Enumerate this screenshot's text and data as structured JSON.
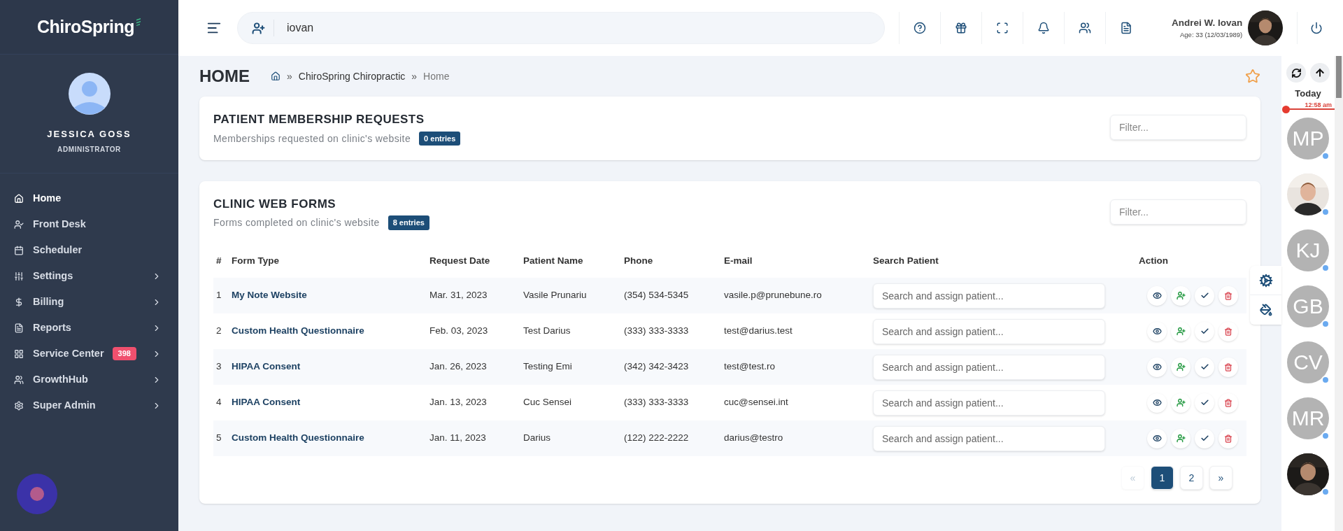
{
  "sidebar": {
    "logo": "ChiroSpring",
    "user": {
      "name": "JESSICA GOSS",
      "role": "ADMINISTRATOR"
    },
    "items": [
      {
        "label": "Home",
        "selected": true,
        "has_submenu": false
      },
      {
        "label": "Front Desk",
        "selected": false,
        "has_submenu": false
      },
      {
        "label": "Scheduler",
        "selected": false,
        "has_submenu": false
      },
      {
        "label": "Settings",
        "selected": false,
        "has_submenu": true
      },
      {
        "label": "Billing",
        "selected": false,
        "has_submenu": true
      },
      {
        "label": "Reports",
        "selected": false,
        "has_submenu": true
      },
      {
        "label": "Service Center",
        "selected": false,
        "has_submenu": true,
        "badge": "398"
      },
      {
        "label": "GrowthHub",
        "selected": false,
        "has_submenu": true
      },
      {
        "label": "Super Admin",
        "selected": false,
        "has_submenu": true
      }
    ]
  },
  "header": {
    "search": {
      "value": "iovan"
    },
    "patient": {
      "name": "Andrei W. Iovan",
      "details": "Age: 33 (12/03/1989)"
    }
  },
  "breadcrumb": {
    "title": "HOME",
    "items": [
      {
        "separator": "»",
        "label": "ChiroSpring Chiropractic"
      },
      {
        "separator": "»",
        "label": "Home"
      }
    ]
  },
  "membership_card": {
    "title": "PATIENT MEMBERSHIP REQUESTS",
    "subtitle": "Memberships requested on clinic's website",
    "badge": "0 entries",
    "filter": {
      "placeholder": "Filter..."
    }
  },
  "web_forms_card": {
    "title": "CLINIC WEB FORMS",
    "subtitle": "Forms completed on clinic's website",
    "badge": "8 entries",
    "filter": {
      "placeholder": "Filter..."
    },
    "table": {
      "columns": [
        "#",
        "Form Type",
        "Request Date",
        "Patient Name",
        "Phone",
        "E-mail",
        "Search Patient",
        "Action"
      ],
      "rows": [
        {
          "number": "1",
          "form_type": "My Note Website",
          "request_date": "Mar. 31, 2023",
          "patient_name": "Vasile Prunariu",
          "phone": "(354) 534-5345",
          "email": "vasile.p@prunebune.ro",
          "search": {
            "placeholder": "Search and assign patient..."
          }
        },
        {
          "number": "2",
          "form_type": "Custom Health Questionnaire",
          "request_date": "Feb. 03, 2023",
          "patient_name": "Test Darius",
          "phone": "(333) 333-3333",
          "email": "test@darius.test",
          "search": {
            "placeholder": "Search and assign patient..."
          }
        },
        {
          "number": "3",
          "form_type": "HIPAA Consent",
          "request_date": "Jan. 26, 2023",
          "patient_name": "Testing Emi",
          "phone": "(342) 342-3423",
          "email": "test@test.ro",
          "search": {
            "placeholder": "Search and assign patient..."
          }
        },
        {
          "number": "4",
          "form_type": "HIPAA Consent",
          "request_date": "Jan. 13, 2023",
          "patient_name": "Cuc Sensei",
          "phone": "(333) 333-3333",
          "email": "cuc@sensei.int",
          "search": {
            "placeholder": "Search and assign patient..."
          }
        },
        {
          "number": "5",
          "form_type": "Custom Health Questionnaire",
          "request_date": "Jan. 11, 2023",
          "patient_name": "Darius",
          "phone": "(122) 222-2222",
          "email": "darius@testro",
          "search": {
            "placeholder": "Search and assign patient..."
          }
        }
      ]
    },
    "pagination": [
      {
        "label": "«",
        "selected": false,
        "disabled": true
      },
      {
        "label": "1",
        "selected": true,
        "disabled": false
      },
      {
        "label": "2",
        "selected": false,
        "disabled": false
      },
      {
        "label": "»",
        "selected": false,
        "disabled": false
      }
    ]
  },
  "schedule_rail": {
    "day": "Today",
    "time": "12:58 am",
    "avatars": [
      {
        "kind": "initials",
        "initials": "MP"
      },
      {
        "kind": "picture"
      },
      {
        "kind": "initials",
        "initials": "KJ"
      },
      {
        "kind": "initials",
        "initials": "GB"
      },
      {
        "kind": "initials",
        "initials": "CV"
      },
      {
        "kind": "initials",
        "initials": "MR"
      },
      {
        "kind": "picture"
      }
    ]
  }
}
